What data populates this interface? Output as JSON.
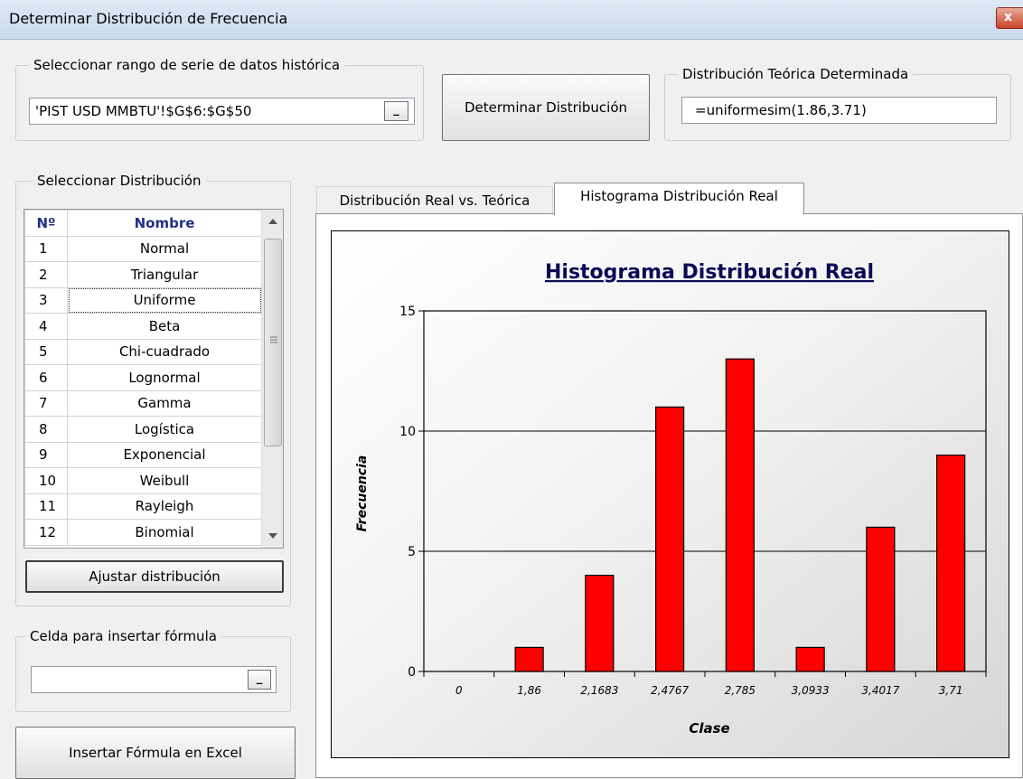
{
  "window": {
    "title": "Determinar Distribución de Frecuencia",
    "close_glyph": "x"
  },
  "range_group": {
    "legend": "Seleccionar rango de serie de datos histórica",
    "value": "'PIST USD MMBTU'!$G$6:$G$50",
    "picker_label": "_"
  },
  "determine_button": "Determinar Distribución",
  "theoretical_group": {
    "legend": "Distribución Teórica Determinada",
    "value": "=uniformesim(1.86,3.71)"
  },
  "distribution_group": {
    "legend": "Seleccionar Distribución",
    "headers": {
      "no": "Nº",
      "name": "Nombre"
    },
    "rows": [
      {
        "no": "1",
        "name": "Normal"
      },
      {
        "no": "2",
        "name": "Triangular"
      },
      {
        "no": "3",
        "name": "Uniforme"
      },
      {
        "no": "4",
        "name": "Beta"
      },
      {
        "no": "5",
        "name": "Chi-cuadrado"
      },
      {
        "no": "6",
        "name": "Lognormal"
      },
      {
        "no": "7",
        "name": "Gamma"
      },
      {
        "no": "8",
        "name": "Logística"
      },
      {
        "no": "9",
        "name": "Exponencial"
      },
      {
        "no": "10",
        "name": "Weibull"
      },
      {
        "no": "11",
        "name": "Rayleigh"
      },
      {
        "no": "12",
        "name": "Binomial"
      }
    ],
    "selected_row": "3",
    "fit_button": "Ajustar distribución"
  },
  "cell_group": {
    "legend": "Celda para insertar fórmula",
    "value": "",
    "picker_label": "_"
  },
  "insert_button": "Insertar Fórmula en Excel",
  "tabs": [
    {
      "label": "Distribución Real vs. Teórica",
      "active": false
    },
    {
      "label": "Histograma Distribución Real",
      "active": true
    }
  ],
  "colors": {
    "bar": "#ff0000",
    "title_text": "#0a0a55"
  },
  "chart_data": {
    "type": "bar",
    "title": "Histograma Distribución Real",
    "xlabel": "Clase",
    "ylabel": "Frecuencia",
    "categories": [
      "0",
      "1,86",
      "2,1683",
      "2,4767",
      "2,785",
      "3,0933",
      "3,4017",
      "3,71"
    ],
    "values": [
      0,
      1,
      4,
      11,
      13,
      1,
      6,
      9
    ],
    "ylim": [
      0,
      15
    ],
    "yticks": [
      0,
      5,
      10,
      15
    ],
    "grid": true
  }
}
